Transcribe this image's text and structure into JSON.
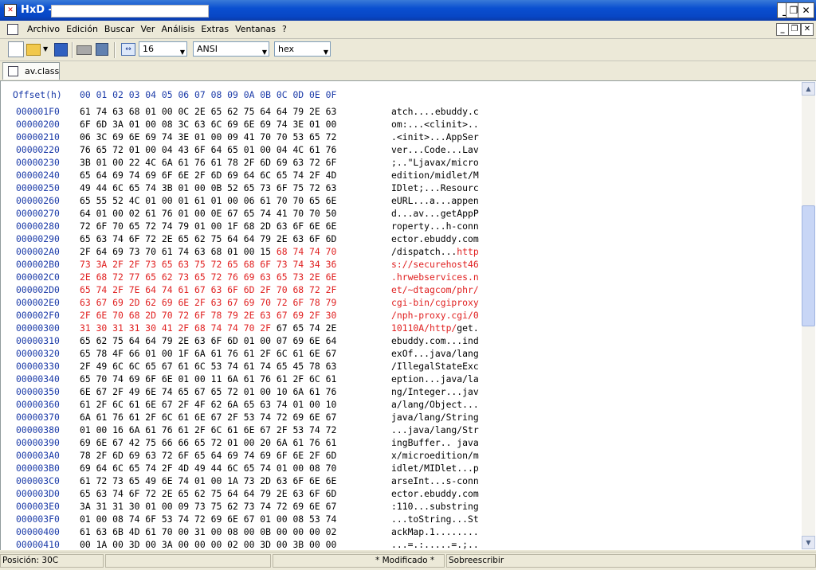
{
  "window": {
    "app_name": "HxD -",
    "title_icon_glyph": "✕"
  },
  "menu": {
    "items": [
      "Archivo",
      "Edición",
      "Buscar",
      "Ver",
      "Análisis",
      "Extras",
      "Ventanas",
      "?"
    ]
  },
  "toolbar": {
    "bytes_per_row": "16",
    "charset": "ANSI",
    "offset_base": "hex"
  },
  "tab": {
    "label": "av.class"
  },
  "editor": {
    "header_label": "Offset(h)",
    "header_columns": "00 01 02 03 04 05 06 07 08 09 0A 0B 0C 0D 0E 0F",
    "highlight_color": "#e02020",
    "rows": [
      {
        "offset": "000001F0",
        "hex": "61 74 63 68 01 00 0C 2E 65 62 75 64 64 79 2E 63",
        "ascii": "atch....ebuddy.c",
        "hl": 0
      },
      {
        "offset": "00000200",
        "hex": "6F 6D 3A 01 00 08 3C 63 6C 69 6E 69 74 3E 01 00",
        "ascii": "om:...<clinit>..",
        "hl": 0
      },
      {
        "offset": "00000210",
        "hex": "06 3C 69 6E 69 74 3E 01 00 09 41 70 70 53 65 72",
        "ascii": ".<init>...AppSer",
        "hl": 0
      },
      {
        "offset": "00000220",
        "hex": "76 65 72 01 00 04 43 6F 64 65 01 00 04 4C 61 76",
        "ascii": "ver...Code...Lav",
        "hl": 0
      },
      {
        "offset": "00000230",
        "hex": "3B 01 00 22 4C 6A 61 76 61 78 2F 6D 69 63 72 6F",
        "ascii": ";..\"Ljavax/micro",
        "hl": 0
      },
      {
        "offset": "00000240",
        "hex": "65 64 69 74 69 6F 6E 2F 6D 69 64 6C 65 74 2F 4D",
        "ascii": "edition/midlet/M",
        "hl": 0
      },
      {
        "offset": "00000250",
        "hex": "49 44 6C 65 74 3B 01 00 0B 52 65 73 6F 75 72 63",
        "ascii": "IDlet;...Resourc",
        "hl": 0
      },
      {
        "offset": "00000260",
        "hex": "65 55 52 4C 01 00 01 61 01 00 06 61 70 70 65 6E",
        "ascii": "eURL...a...appen",
        "hl": 0
      },
      {
        "offset": "00000270",
        "hex": "64 01 00 02 61 76 01 00 0E 67 65 74 41 70 70 50",
        "ascii": "d...av...getAppP",
        "hl": 0
      },
      {
        "offset": "00000280",
        "hex": "72 6F 70 65 72 74 79 01 00 1F 68 2D 63 6F 6E 6E",
        "ascii": "roperty...h-conn",
        "hl": 0
      },
      {
        "offset": "00000290",
        "hex": "65 63 74 6F 72 2E 65 62 75 64 64 79 2E 63 6F 6D",
        "ascii": "ector.ebuddy.com",
        "hl": 0
      },
      {
        "offset": "000002A0",
        "hex": "2F 64 69 73 70 61 74 63 68 01 00 15 ",
        "hex_hl": "68 74 74 70",
        "ascii": "/dispatch...",
        "ascii_hl": "http",
        "hl": 1
      },
      {
        "offset": "000002B0",
        "hex": "",
        "hex_hl": "73 3A 2F 2F 73 65 63 75 72 65 68 6F 73 74 34 36",
        "ascii": "",
        "ascii_hl": "s://securehost46",
        "hl": 1
      },
      {
        "offset": "000002C0",
        "hex": "",
        "hex_hl": "2E 68 72 77 65 62 73 65 72 76 69 63 65 73 2E 6E",
        "ascii": "",
        "ascii_hl": ".hrwebservices.n",
        "hl": 1
      },
      {
        "offset": "000002D0",
        "hex": "",
        "hex_hl": "65 74 2F 7E 64 74 61 67 63 6F 6D 2F 70 68 72 2F",
        "ascii": "",
        "ascii_hl": "et/~dtagcom/phr/",
        "hl": 1
      },
      {
        "offset": "000002E0",
        "hex": "",
        "hex_hl": "63 67 69 2D 62 69 6E 2F 63 67 69 70 72 6F 78 79",
        "ascii": "",
        "ascii_hl": "cgi-bin/cgiproxy",
        "hl": 1
      },
      {
        "offset": "000002F0",
        "hex": "",
        "hex_hl": "2F 6E 70 68 2D 70 72 6F 78 79 2E 63 67 69 2F 30",
        "ascii": "",
        "ascii_hl": "/nph-proxy.cgi/0",
        "hl": 1
      },
      {
        "offset": "00000300",
        "hex": "",
        "hex_hl": "31 30 31 31 30 41 2F 68 74 74 70 2F",
        "hex_tail": " 67 65 74 2E",
        "ascii": "",
        "ascii_hl": "10110A/http/",
        "ascii_tail": "get.",
        "hl": 1
      },
      {
        "offset": "00000310",
        "hex": "65 62 75 64 64 79 2E 63 6F 6D 01 00 07 69 6E 64",
        "ascii": "ebuddy.com...ind",
        "hl": 0
      },
      {
        "offset": "00000320",
        "hex": "65 78 4F 66 01 00 1F 6A 61 76 61 2F 6C 61 6E 67",
        "ascii": "exOf...java/lang",
        "hl": 0
      },
      {
        "offset": "00000330",
        "hex": "2F 49 6C 6C 65 67 61 6C 53 74 61 74 65 45 78 63",
        "ascii": "/IllegalStateExc",
        "hl": 0
      },
      {
        "offset": "00000340",
        "hex": "65 70 74 69 6F 6E 01 00 11 6A 61 76 61 2F 6C 61",
        "ascii": "eption...java/la",
        "hl": 0
      },
      {
        "offset": "00000350",
        "hex": "6E 67 2F 49 6E 74 65 67 65 72 01 00 10 6A 61 76",
        "ascii": "ng/Integer...jav",
        "hl": 0
      },
      {
        "offset": "00000360",
        "hex": "61 2F 6C 61 6E 67 2F 4F 62 6A 65 63 74 01 00 10",
        "ascii": "a/lang/Object...",
        "hl": 0
      },
      {
        "offset": "00000370",
        "hex": "6A 61 76 61 2F 6C 61 6E 67 2F 53 74 72 69 6E 67",
        "ascii": "java/lang/String",
        "hl": 0
      },
      {
        "offset": "00000380",
        "hex": "01 00 16 6A 61 76 61 2F 6C 61 6E 67 2F 53 74 72",
        "ascii": "...java/lang/Str",
        "hl": 0
      },
      {
        "offset": "00000390",
        "hex": "69 6E 67 42 75 66 66 65 72 01 00 20 6A 61 76 61",
        "ascii": "ingBuffer.. java",
        "hl": 0
      },
      {
        "offset": "000003A0",
        "hex": "78 2F 6D 69 63 72 6F 65 64 69 74 69 6F 6E 2F 6D",
        "ascii": "x/microedition/m",
        "hl": 0
      },
      {
        "offset": "000003B0",
        "hex": "69 64 6C 65 74 2F 4D 49 44 6C 65 74 01 00 08 70",
        "ascii": "idlet/MIDlet...p",
        "hl": 0
      },
      {
        "offset": "000003C0",
        "hex": "61 72 73 65 49 6E 74 01 00 1A 73 2D 63 6F 6E 6E",
        "ascii": "arseInt...s-conn",
        "hl": 0
      },
      {
        "offset": "000003D0",
        "hex": "65 63 74 6F 72 2E 65 62 75 64 64 79 2E 63 6F 6D",
        "ascii": "ector.ebuddy.com",
        "hl": 0
      },
      {
        "offset": "000003E0",
        "hex": "3A 31 31 30 01 00 09 73 75 62 73 74 72 69 6E 67",
        "ascii": ":110...substring",
        "hl": 0
      },
      {
        "offset": "000003F0",
        "hex": "01 00 08 74 6F 53 74 72 69 6E 67 01 00 08 53 74",
        "ascii": "...toString...St",
        "hl": 0
      },
      {
        "offset": "00000400",
        "hex": "61 63 6B 4D 61 70 00 31 00 08 00 0B 00 00 00 02",
        "ascii": "ackMap.1........",
        "hl": 0
      },
      {
        "offset": "00000410",
        "hex": "00 1A 00 3D 00 3A 00 00 00 02 00 3D 00 3B 00 00",
        "ascii": "...=.:.....=.;..",
        "hl": 0
      }
    ]
  },
  "statusbar": {
    "position": "Posición: 30C",
    "modified": "* Modificado *",
    "mode": "Sobreescribir"
  }
}
